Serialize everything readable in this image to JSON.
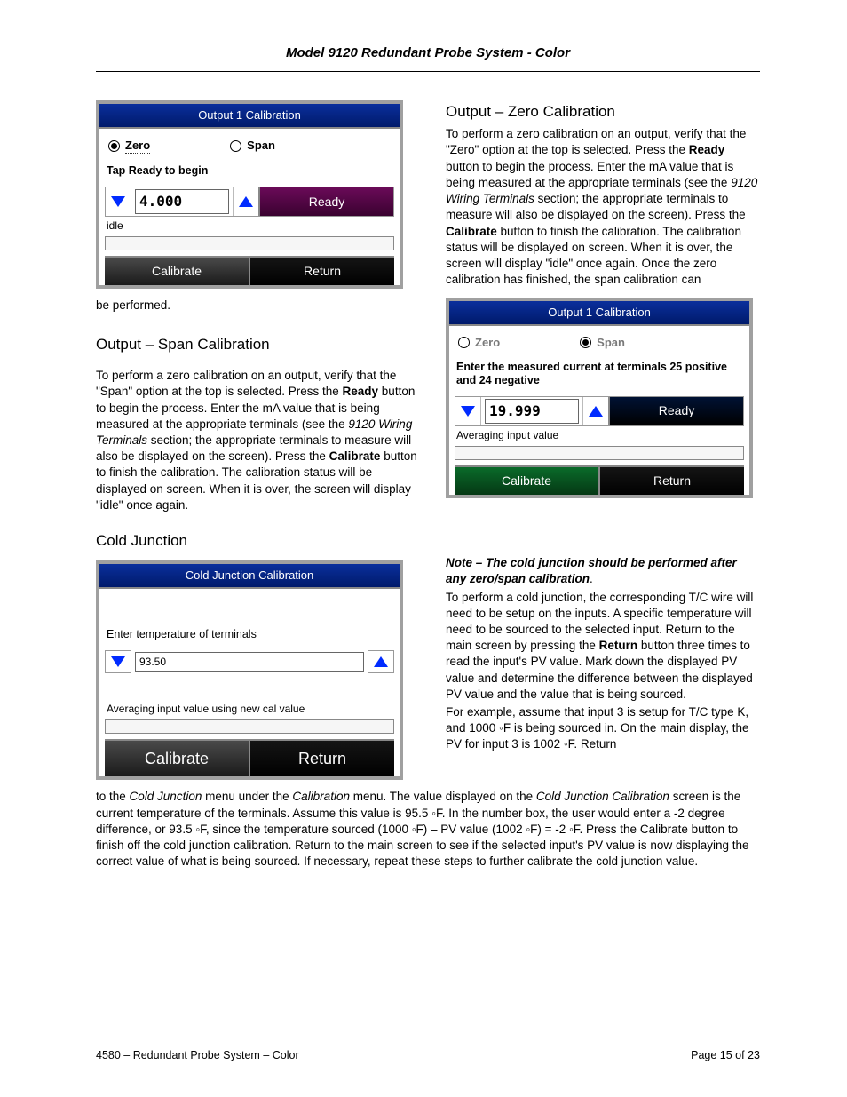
{
  "page_title": "Model 9120 Redundant Probe System - Color",
  "footer_left": "4580 – Redundant Probe System – Color",
  "footer_right": "Page 15 of 23",
  "heading_zero": "Output – Zero Calibration",
  "heading_span": "Output – Span Calibration",
  "heading_cold": "Cold Junction",
  "fig1": {
    "title": "Output 1 Calibration",
    "radio_zero": "Zero",
    "radio_span": "Span",
    "instruction": "Tap Ready to begin",
    "value": "4.000",
    "ready": "Ready",
    "status": "idle",
    "calibrate": "Calibrate",
    "return": "Return"
  },
  "fig2": {
    "title": "Output 1 Calibration",
    "radio_zero": "Zero",
    "radio_span": "Span",
    "instruction": "Enter the measured current at terminals 25 positive and 24 negative",
    "value": "19.999",
    "ready": "Ready",
    "status": "Averaging input value",
    "calibrate": "Calibrate",
    "return": "Return"
  },
  "fig3": {
    "title": "Cold Junction Calibration",
    "instruction": "Enter temperature of terminals",
    "value": "93.50",
    "status": "Averaging input value using new cal value",
    "calibrate": "Calibrate",
    "return": "Return"
  },
  "para_zero_1": "To perform a zero calibration on an output, verify that the \"Zero\" option at the top is selected.  Press the ",
  "para_zero_ready": "Ready",
  "para_zero_2": " button to begin the process.  Enter the mA value that is being measured at the appropriate terminals (see the ",
  "para_zero_ref": "9120 Wiring Terminals",
  "para_zero_3": " section; the appropriate terminals to measure will also be displayed on the screen).  Press the ",
  "para_zero_calib": "Calibrate",
  "para_zero_4": " button to finish the calibration.  The calibration status will be displayed on screen.  When it is over, the screen will display \"idle\" once again.  Once the zero calibration has finished, the span calibration can ",
  "para_zero_tail": "be performed.",
  "para_span_1": "To perform a zero calibration on an output, verify that the \"Span\" option at the top is selected.  Press the ",
  "para_span_ready": "Ready",
  "para_span_2": " button to begin the process.  Enter the mA value that is being measured at the appropriate terminals (see the ",
  "para_span_ref": "9120 Wiring Terminals",
  "para_span_3": " section; the appropriate terminals to measure will also be displayed on the screen).  Press the ",
  "para_span_calib": "Calibrate",
  "para_span_4": " button to finish the calibration.  The calibration status will be displayed on screen.  When it is over, the screen will display \"idle\" once again.",
  "note_cold": "Note – The cold junction should be performed after any zero/span calibration",
  "para_cold_r1": "To perform a cold junction, the corresponding T/C wire will need to be setup on the inputs.  A specific temperature will need to be sourced to the selected input.  Return to the main screen by pressing the ",
  "para_cold_return": "Return",
  "para_cold_r2": " button three times to read the input's PV value.  Mark down the displayed PV value and determine the difference between the displayed PV value and the value that is being sourced.",
  "para_cold_r3": "For example, assume that input 3 is setup for T/C type K, and 1000 ◦F is being sourced in.  On the main display, the PV for input 3 is 1002 ◦F.  Return ",
  "para_cold_tail_1": "to the ",
  "para_cold_tail_it1": "Cold Junction",
  "para_cold_tail_2": " menu under the ",
  "para_cold_tail_it2": "Calibration",
  "para_cold_tail_3": " menu.   The value displayed on the ",
  "para_cold_tail_it3": "Cold Junction Calibration",
  "para_cold_tail_4": " screen is the current temperature of the terminals.  Assume this value is 95.5 ◦F. In the number box, the user would enter a -2 degree difference, or 93.5 ◦F, since the temperature sourced (1000 ◦F) – PV value (1002 ◦F) = -2 ◦F.  Press the Calibrate button to finish off the cold junction calibration.  Return to the main screen to see if the selected input's PV value is now displaying the correct value of what is being sourced.  If necessary, repeat these steps to further calibrate the cold junction value."
}
